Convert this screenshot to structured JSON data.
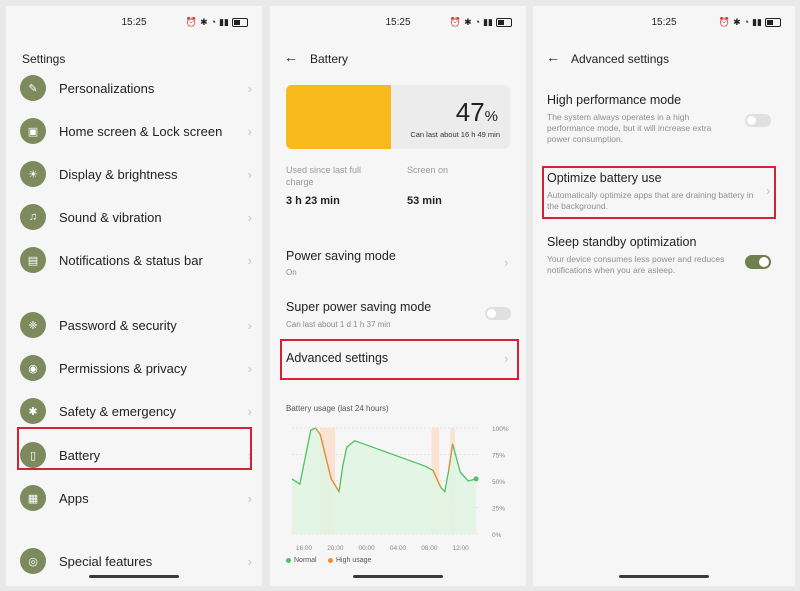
{
  "panel1": {
    "time": "15:25",
    "title": "Settings",
    "items": [
      {
        "label": "Personalizations",
        "icon": "brush-icon",
        "glyph": "✎"
      },
      {
        "label": "Home screen & Lock screen",
        "icon": "image-icon",
        "glyph": "▣"
      },
      {
        "label": "Display & brightness",
        "icon": "sun-icon",
        "glyph": "☀"
      },
      {
        "label": "Sound & vibration",
        "icon": "bell-icon",
        "glyph": "♫"
      },
      {
        "label": "Notifications & status bar",
        "icon": "notification-icon",
        "glyph": "▤"
      },
      {
        "label": "Password & security",
        "icon": "shield-icon",
        "glyph": "❈"
      },
      {
        "label": "Permissions & privacy",
        "icon": "eye-icon",
        "glyph": "◉"
      },
      {
        "label": "Safety & emergency",
        "icon": "star-icon",
        "glyph": "✱"
      },
      {
        "label": "Battery",
        "icon": "battery-icon",
        "glyph": "▯"
      },
      {
        "label": "Apps",
        "icon": "apps-grid-icon",
        "glyph": "▦"
      },
      {
        "label": "Special features",
        "icon": "special-features-icon",
        "glyph": "◎"
      }
    ]
  },
  "panel2": {
    "time": "15:25",
    "title": "Battery",
    "battery_percent": 47,
    "battery_percent_number": "47",
    "battery_percent_sign": "%",
    "battery_sub": "Can last about 16 h 49 min",
    "used_label": "Used since last full charge",
    "used_value": "3 h 23 min",
    "screen_label": "Screen on",
    "screen_value": "53 min",
    "power_saving_title": "Power saving mode",
    "power_saving_sub": "On",
    "super_saving_title": "Super power saving mode",
    "super_saving_sub": "Can last about 1 d 1 h 37 min",
    "advanced_label": "Advanced settings",
    "chart_title": "Battery usage (last 24 hours)",
    "legend_normal": "Normal",
    "legend_high": "High usage",
    "colors": {
      "battery_fill": "#f8b91a",
      "normal": "#4cc263",
      "high_usage": "#f08a3c",
      "highlight": "#d32234"
    }
  },
  "panel3": {
    "time": "15:25",
    "title": "Advanced settings",
    "high_perf_title": "High performance mode",
    "high_perf_desc": "The system always operates in a high performance mode, but it will increase extra power consumption.",
    "optimize_title": "Optimize battery use",
    "optimize_desc": "Automatically optimize apps that are draining battery in the background.",
    "sleep_title": "Sleep standby optimization",
    "sleep_desc": "Your device consumes less power and reduces notifications when you are asleep."
  },
  "chart_data": {
    "type": "area",
    "title": "Battery usage (last 24 hours)",
    "x_tick_labels": [
      "16:00",
      "20:00",
      "00:00",
      "04:00",
      "08:00",
      "12:00"
    ],
    "y_tick_labels": [
      "100%",
      "75%",
      "50%",
      "25%",
      "0%"
    ],
    "ylim": [
      0,
      100
    ],
    "xlim": [
      0,
      24
    ],
    "series": [
      {
        "name": "Normal",
        "x": [
          0,
          1,
          2.4,
          3,
          3.6,
          5,
          6,
          6.5,
          7,
          8,
          11,
          14,
          17,
          18,
          19,
          19.5,
          20,
          20.5,
          21.5,
          22.5,
          23.5
        ],
        "y": [
          52,
          47,
          98,
          100,
          94,
          52,
          40,
          65,
          82,
          88,
          80,
          72,
          64,
          60,
          44,
          40,
          60,
          85,
          58,
          50,
          52
        ]
      }
    ],
    "high_usage_periods": [
      [
        3.6,
        5.5
      ],
      [
        17.8,
        18.8
      ],
      [
        20.2,
        20.8
      ]
    ]
  }
}
